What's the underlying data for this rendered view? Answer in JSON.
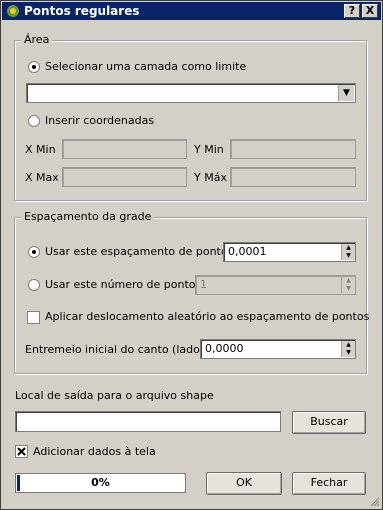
{
  "window": {
    "title": "Pontos regulares",
    "help_label": "?",
    "close_label": "X"
  },
  "area": {
    "title": "Área",
    "option_layer": "Selecionar uma camada como limite",
    "layer_value": "",
    "option_coords": "Inserir coordenadas",
    "xmin_label": "X Min",
    "ymin_label": "Y Min",
    "xmax_label": "X Max",
    "ymax_label": "Y Máx",
    "xmin_value": "",
    "ymin_value": "",
    "xmax_value": "",
    "ymax_value": ""
  },
  "grid": {
    "title": "Espaçamento da grade",
    "option_spacing": "Usar este espaçamento de pontos",
    "spacing_value": "0,0001",
    "option_count": "Usar este número de pontos",
    "count_value": "1",
    "random_label": "Aplicar deslocamento aleatório ao espaçamento de pontos",
    "inset_label": "Entremeio inicial do canto (lado LH)",
    "inset_value": "0,0000"
  },
  "output": {
    "label": "Local de saída para o arquivo shape",
    "path_value": "",
    "browse_label": "Buscar",
    "add_label": "Adicionar dados à tela",
    "add_checked": true
  },
  "progress": {
    "text": "0%",
    "value": 0.02
  },
  "buttons": {
    "ok": "OK",
    "close": "Fechar"
  }
}
